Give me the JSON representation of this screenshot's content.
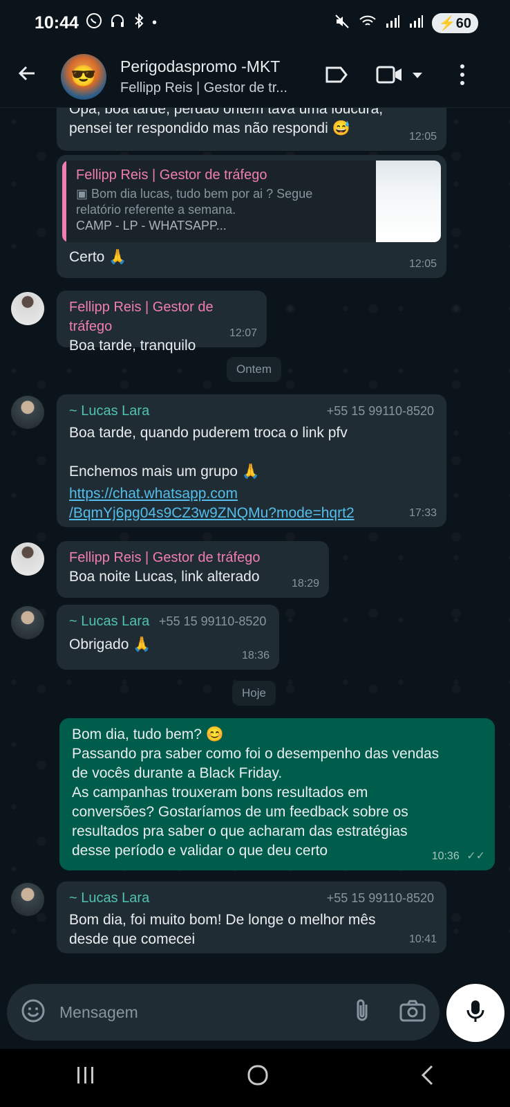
{
  "status_bar": {
    "time": "10:44",
    "battery": "60"
  },
  "header": {
    "title": "Perigodaspromo -MKT",
    "subtitle": "Fellipp Reis | Gestor de tr..."
  },
  "messages": {
    "m1": {
      "text_line1": "Opa, boa tarde, perdão ontem tava uma loucura,",
      "text_line2": "pensei ter respondido mas não respondi 😅",
      "time": "12:05"
    },
    "m2": {
      "quote_sender": "Fellipp Reis | Gestor de tráfego",
      "quote_line1": "Bom dia lucas, tudo bem por ai ? Segue",
      "quote_line2": "relatório referente a semana.",
      "quote_line3": "CAMP - LP - WHATSAPP...",
      "text": "Certo 🙏",
      "time": "12:05"
    },
    "m3": {
      "sender": "Fellipp Reis | Gestor de tráfego",
      "text": "Boa tarde, tranquilo",
      "time": "12:07"
    },
    "day1": "Ontem",
    "m4": {
      "sender": "~ Lucas Lara",
      "phone": "+55 15 99110-8520",
      "line1": "Boa tarde, quando puderem troca o link pfv",
      "line2": "Enchemos mais um grupo 🙏",
      "link1": "https://chat.whatsapp.com",
      "link2": "/BqmYj6pg04s9CZ3w9ZNQMu?mode=hqrt2",
      "time": "17:33"
    },
    "m5": {
      "sender": "Fellipp Reis | Gestor de tráfego",
      "text": "Boa noite Lucas, link alterado",
      "time": "18:29"
    },
    "m6": {
      "sender": "~ Lucas Lara",
      "phone": "+55 15 99110-8520",
      "text": "Obrigado 🙏",
      "time": "18:36"
    },
    "day2": "Hoje",
    "m7": {
      "line1": "Bom dia, tudo bem? 😊",
      "line2": "Passando pra saber como foi o desempenho das vendas",
      "line3": "de vocês durante a Black Friday.",
      "line4": "As campanhas trouxeram bons resultados em",
      "line5": "conversões? Gostaríamos de um feedback sobre os",
      "line6": "resultados pra saber o que acharam  das estratégias",
      "line7": "desse período e validar o que deu certo",
      "time": "10:36"
    },
    "m8": {
      "sender": "~ Lucas Lara",
      "phone": "+55 15 99110-8520",
      "line1": "Bom dia, foi muito bom! De longe o melhor mês",
      "line2": "desde que comecei",
      "time": "10:41"
    }
  },
  "composer": {
    "placeholder": "Mensagem"
  },
  "icons": {
    "back": "arrow-left",
    "label": "label-tag",
    "video": "video-camera",
    "menu": "more-vertical",
    "emoji": "emoji",
    "attach": "paperclip",
    "camera": "camera",
    "mic": "microphone"
  },
  "colors": {
    "outgoing_bubble": "#005c4b",
    "incoming_bubble": "#202c33",
    "fellipp_name": "#f17eb0",
    "lucas_name": "#4fc3b0",
    "link": "#53bdeb"
  }
}
